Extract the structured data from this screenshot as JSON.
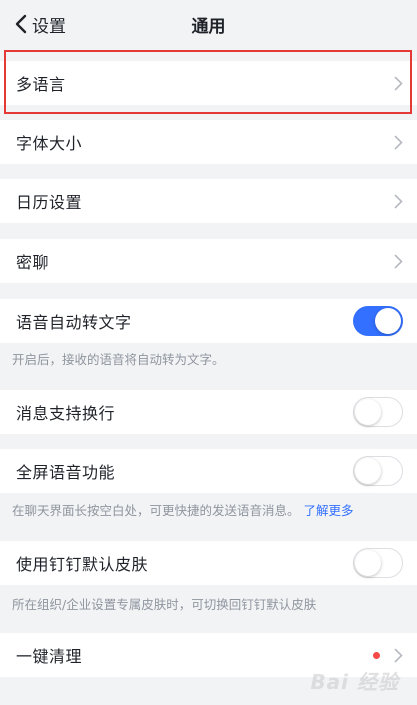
{
  "nav": {
    "back_label": "设置",
    "title": "通用"
  },
  "rows": {
    "multilang": "多语言",
    "font_size": "字体大小",
    "calendar": "日历设置",
    "secret_chat": "密聊",
    "voice_to_text": "语音自动转文字",
    "msg_linebreak": "消息支持换行",
    "fullscreen_voice": "全屏语音功能",
    "default_skin": "使用钉钉默认皮肤",
    "one_key_clean": "一键清理"
  },
  "toggles": {
    "voice_to_text": true,
    "msg_linebreak": false,
    "fullscreen_voice": false,
    "default_skin": false
  },
  "hints": {
    "voice_to_text": "开启后，接收的语音将自动转为文字。",
    "fullscreen_voice": "在聊天界面长按空白处，可更快捷的发送语音消息。",
    "fullscreen_voice_link": "了解更多",
    "default_skin": "所在组织/企业设置专属皮肤时，可切换回钉钉默认皮肤"
  },
  "watermark": "Bai 经验",
  "colors": {
    "accent": "#3370ff",
    "highlight": "#e53935",
    "badge": "#f54a45"
  }
}
